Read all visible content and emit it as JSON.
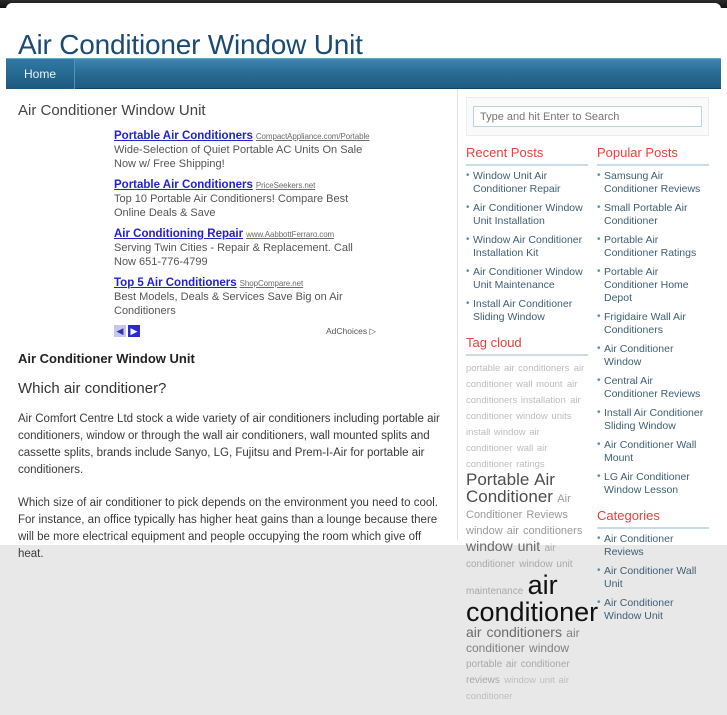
{
  "site": {
    "title": "Air Conditioner Window Unit"
  },
  "nav": {
    "items": [
      {
        "label": "Home"
      }
    ]
  },
  "main": {
    "entry_title": "Air Conditioner Window Unit",
    "ads": {
      "items": [
        {
          "title": "Portable Air Conditioners",
          "url": "CompactAppliance.com/Portable",
          "desc": "Wide-Selection of Quiet Portable AC Units On Sale Now w/ Free Shipping!"
        },
        {
          "title": "Portable Air Conditioners",
          "url": "PriceSeekers.net",
          "desc": "Top 10 Portable Air Conditioners! Compare Best Online Deals & Save"
        },
        {
          "title": "Air Conditioning Repair",
          "url": "www.AabbottFerraro.com",
          "desc": "Serving Twin Cities - Repair & Replacement. Call Now 651-776-4799"
        },
        {
          "title": "Top 5 Air Conditioners",
          "url": "ShopCompare.net",
          "desc": "Best Models, Deals & Services Save Big on Air Conditioners"
        }
      ],
      "prev_icon": "◀",
      "next_icon": "▶",
      "adchoices_label": "AdChoices",
      "adchoices_icon": "▷"
    },
    "post": {
      "title": "Air Conditioner Window Unit",
      "heading": "Which air conditioner?",
      "paragraphs": [
        "Air Comfort Centre Ltd stock a wide variety of air conditioners including portable air conditioners, window or through the wall air conditioners, wall mounted splits and cassette splits, brands include Sanyo, LG, Fujitsu and Prem-I-Air for portable air conditioners.",
        "Which size of air conditioner to pick depends on the environment you need to cool. For instance, an office typically has higher heat gains than a lounge because there will be more electrical equipment and people occupying the room which give off heat."
      ]
    }
  },
  "sidebar": {
    "search": {
      "placeholder": "Type and hit Enter to Search",
      "value": ""
    },
    "recent_posts": {
      "title": "Recent Posts",
      "items": [
        "Window Unit Air Conditioner Repair",
        "Air Conditioner Window Unit Installation",
        "Window Air Conditioner Installation Kit",
        "Air Conditioner Window Unit Maintenance",
        "Install Air Conditioner Sliding Window"
      ]
    },
    "popular_posts": {
      "title": "Popular Posts",
      "items": [
        "Samsung Air Conditioner Reviews",
        "Small Portable Air Conditioner",
        "Portable Air Conditioner Ratings",
        "Portable Air Conditioner Home Depot",
        "Frigidaire Wall Air Conditioners",
        "Air Conditioner Window",
        "Central Air Conditioner Reviews",
        "Install Air Conditioner Sliding Window",
        "Air Conditioner Wall Mount",
        "LG Air Conditioner Window Lesson"
      ]
    },
    "tag_cloud": {
      "title": "Tag cloud",
      "tags": [
        {
          "label": "portable air conditioners",
          "size": 2
        },
        {
          "label": "air conditioner wall mount",
          "size": 2
        },
        {
          "label": "air conditioners installation",
          "size": 2
        },
        {
          "label": "air conditioner window units",
          "size": 2
        },
        {
          "label": "install window air conditioner",
          "size": 2
        },
        {
          "label": "wall air conditioner ratings",
          "size": 2
        },
        {
          "label": "Portable Air Conditioner",
          "size": 7
        },
        {
          "label": "Air Conditioner Reviews",
          "size": 4
        },
        {
          "label": "window air conditioners",
          "size": 4
        },
        {
          "label": "window unit",
          "size": 6
        },
        {
          "label": "air conditioner",
          "size": 3
        },
        {
          "label": "window unit maintenance",
          "size": 3
        },
        {
          "label": "air conditioner",
          "size": 9
        },
        {
          "label": "air conditioners",
          "size": 6
        },
        {
          "label": "air conditioner window",
          "size": 5
        },
        {
          "label": "portable air conditioner reviews",
          "size": 3
        },
        {
          "label": "window unit air conditioner",
          "size": 3
        }
      ]
    },
    "categories": {
      "title": "Categories",
      "items": [
        "Air Conditioner Reviews",
        "Air Conditioner Wall Unit",
        "Air Conditioner Window Unit"
      ]
    }
  }
}
